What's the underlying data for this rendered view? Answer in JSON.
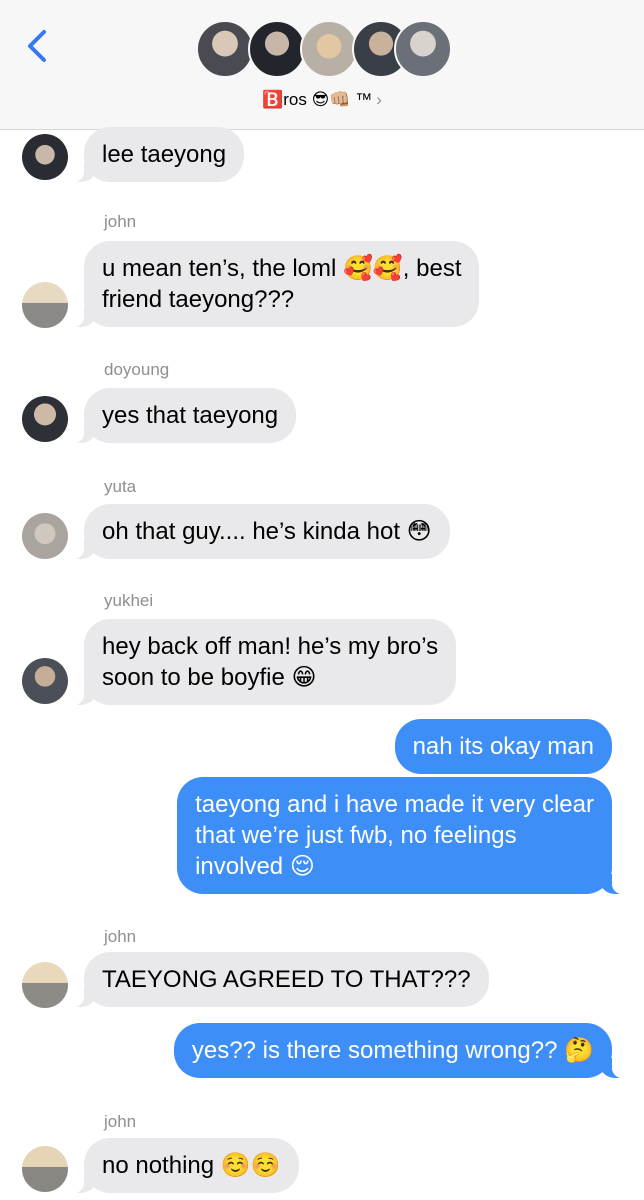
{
  "header": {
    "group_name": "🅱️ros 😎👊🏼 ™",
    "chevron": "›",
    "back_icon": "chevron-left-icon",
    "accent": "#3478f6"
  },
  "messages": [
    {
      "sender": "",
      "text": "lee taeyong",
      "from": "in"
    },
    {
      "sender": "john",
      "text": "u mean ten’s, the loml 🥰🥰, best\nfriend taeyong???",
      "from": "in"
    },
    {
      "sender": "doyoung",
      "text": "yes that taeyong",
      "from": "in"
    },
    {
      "sender": "yuta",
      "text": "oh that guy.... he’s kinda hot 😳",
      "from": "in"
    },
    {
      "sender": "yukhei",
      "text": "hey back off man! he’s my bro’s\nsoon to be boyfie 😁",
      "from": "in"
    },
    {
      "sender": "",
      "text": "nah its okay man",
      "from": "out"
    },
    {
      "sender": "",
      "text": "taeyong and i have made it very clear\nthat we’re just fwb, no feelings\ninvolved 😌",
      "from": "out"
    },
    {
      "sender": "john",
      "text": "TAEYONG AGREED TO THAT???",
      "from": "in"
    },
    {
      "sender": "",
      "text": "yes?? is there something wrong?? 🤔",
      "from": "out"
    },
    {
      "sender": "john",
      "text": "no nothing ☺️☺️",
      "from": "in"
    }
  ],
  "colors": {
    "incoming_bubble": "#e9e9eb",
    "outgoing_bubble": "#3e8ef7",
    "sender_label": "#8e8e93"
  }
}
